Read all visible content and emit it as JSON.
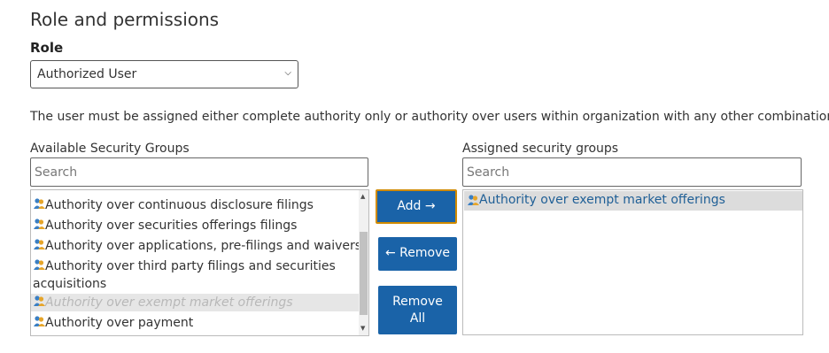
{
  "section": {
    "title": "Role and permissions"
  },
  "role": {
    "label": "Role",
    "selected": "Authorized User"
  },
  "info_text": "The user must be assigned either complete authority only or authority over users within organization with any other combination",
  "available": {
    "label": "Available Security Groups",
    "search_placeholder": "Search",
    "items": [
      "Authority over continuous disclosure filings",
      "Authority over securities offerings filings",
      "Authority over applications, pre-filings and waivers",
      "Authority over third party filings and securities",
      "acquisitions",
      "Authority over exempt market offerings",
      "Authority over payment"
    ]
  },
  "buttons": {
    "add": "Add →",
    "remove": "← Remove",
    "remove_all_1": "Remove",
    "remove_all_2": "All"
  },
  "assigned": {
    "label": "Assigned security groups",
    "search_placeholder": "Search",
    "items": [
      "Authority over exempt market offerings"
    ]
  },
  "icons": {
    "group": "user-group-icon",
    "chevron": "chevron-down-icon"
  }
}
